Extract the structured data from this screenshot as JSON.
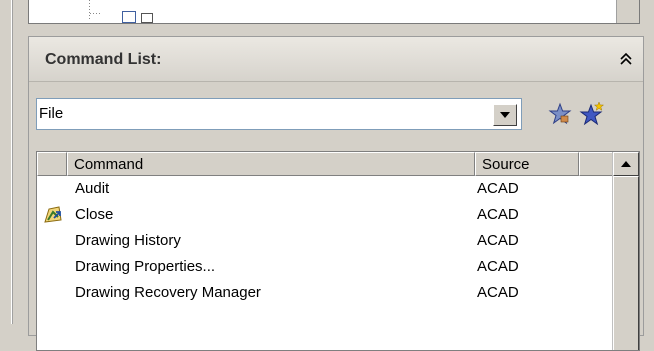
{
  "tree_panel": {
    "node_label": ""
  },
  "command_list": {
    "title": "Command List:",
    "category": {
      "selected": "File"
    },
    "columns": {
      "icon": "",
      "command": "Command",
      "source": "Source"
    },
    "rows": [
      {
        "command": "Audit",
        "source": "ACAD",
        "icon": "none"
      },
      {
        "command": "Close",
        "source": "ACAD",
        "icon": "close-drawing-icon"
      },
      {
        "command": "Drawing History",
        "source": "ACAD",
        "icon": "none"
      },
      {
        "command": "Drawing Properties...",
        "source": "ACAD",
        "icon": "none"
      },
      {
        "command": "Drawing Recovery Manager",
        "source": "ACAD",
        "icon": "none"
      }
    ]
  },
  "colors": {
    "panel_bg": "#d4d0c8",
    "header_bg": "#e4e1db",
    "list_bg": "#ffffff",
    "border": "#7f9db9"
  }
}
